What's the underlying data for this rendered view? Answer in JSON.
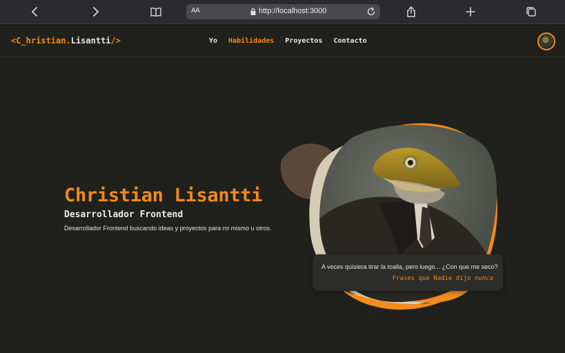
{
  "browser": {
    "url_aa": "AA",
    "url": "http://localhost:3000",
    "icons": [
      "chevron-left-icon",
      "chevron-right-icon",
      "book-icon",
      "lock-icon",
      "reload-icon",
      "share-icon",
      "plus-icon",
      "tabs-icon"
    ]
  },
  "site": {
    "logo": {
      "open": "<C",
      "name_first": "_hristian",
      "dot": ".",
      "name_last": "Lisantti",
      "close": "/>"
    },
    "nav": [
      {
        "label": "Yo",
        "active": false
      },
      {
        "label": "Habilidades",
        "active": true
      },
      {
        "label": "Proyectos",
        "active": false
      },
      {
        "label": "Contacto",
        "active": false
      }
    ],
    "accent_color": "#f28a1c",
    "background_color": "#20201c"
  },
  "hero": {
    "name": "Christian Lisantti",
    "role": "Desarrollador Frontend",
    "description": "Desarrollador Frontend buscando ideas y proyectos para mi mismo u otros."
  },
  "quote": {
    "text": "A veces quisiera tirar la toalla, pero luego... ¿Con que me seco?",
    "author_prefix": "Frases que Nadie dijo",
    "author_emphasis": "nunca"
  }
}
